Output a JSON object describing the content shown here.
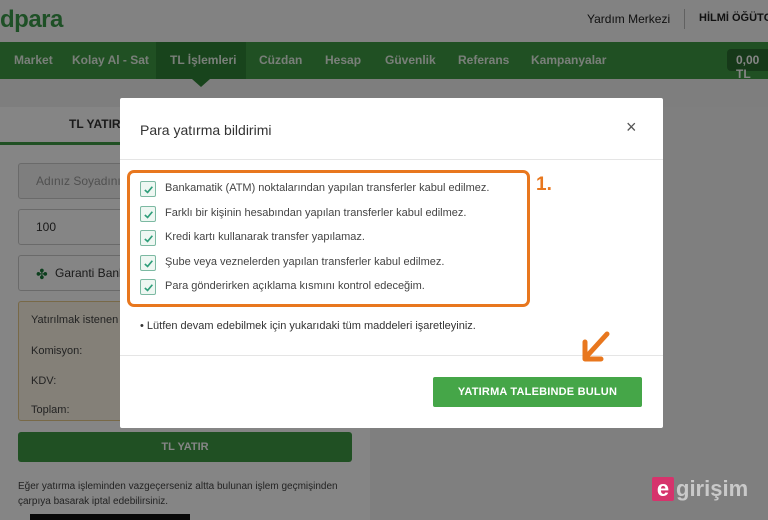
{
  "header": {
    "logo": "dpara",
    "help_link": "Yardım Merkezi",
    "user_name": "HİLMİ ÖĞÜTCÜ"
  },
  "nav": {
    "items": [
      "Market",
      "Kolay Al - Sat",
      "TL İşlemleri",
      "Cüzdan",
      "Hesap",
      "Güvenlik",
      "Referans",
      "Kampanyalar"
    ],
    "active": "TL İşlemleri",
    "balance": "0,00 TL"
  },
  "deposit_form": {
    "tab_label": "TL YATIR",
    "name_placeholder": "Adınız Soyadınız",
    "amount_value": "100",
    "bank_value": "Garanti Bankası",
    "summary": {
      "requested_label": "Yatırılmak istenen",
      "commission_label": "Komisyon:",
      "vat_label": "KDV:",
      "total_label": "Toplam:"
    },
    "submit_label": "TL YATIR",
    "cancel_note": "Eğer yatırma işleminden vazgeçerseniz altta bulunan işlem geçmişinden çarpıya basarak iptal edebilirsiniz."
  },
  "modal": {
    "title": "Para yatırma bildirimi",
    "close_symbol": "×",
    "step_annotation": "1.",
    "checklist": [
      {
        "label": "Bankamatik (ATM) noktalarından yapılan transferler kabul edilmez.",
        "checked": true
      },
      {
        "label": "Farklı bir kişinin hesabından yapılan transferler kabul edilmez.",
        "checked": true
      },
      {
        "label": "Kredi kartı kullanarak transfer yapılamaz.",
        "checked": true
      },
      {
        "label": "Şube veya veznelerden yapılan transferler kabul edilmez.",
        "checked": true
      },
      {
        "label": "Para gönderirken açıklama kısmını kontrol edeceğim.",
        "checked": true
      }
    ],
    "notice": "• Lütfen devam edebilmek için yukarıdaki tüm maddeleri işaretleyiniz.",
    "submit_label": "YATIRMA TALEBINDE BULUN"
  },
  "watermark": {
    "badge": "e",
    "text": "girişim"
  },
  "colors": {
    "brand_green": "#3f9a44",
    "annotation_orange": "#e8771e",
    "check_teal": "#2f9e7a"
  }
}
